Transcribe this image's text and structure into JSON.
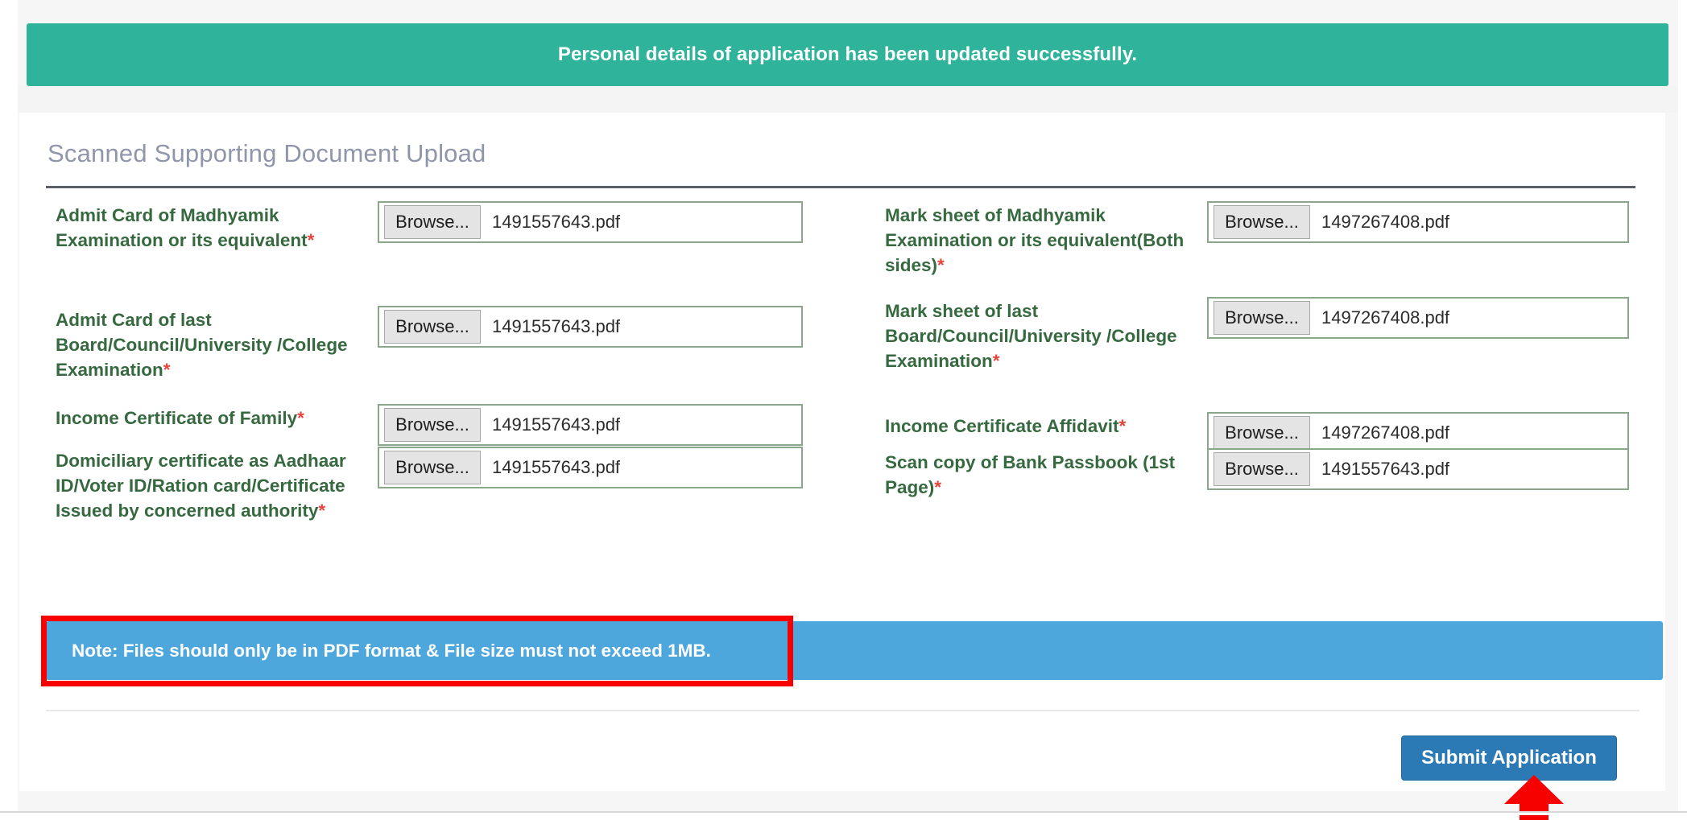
{
  "alert": {
    "message": "Personal details of application has been updated successfully.",
    "background_color": "#2fb39a",
    "text_color": "#ffffff"
  },
  "panel": {
    "title": "Scanned Supporting Document Upload",
    "title_color": "#8f96ab"
  },
  "uploads": [
    {
      "label": "Admit Card of Madhyamik Examination or its equivalent",
      "required": "*",
      "browse_label": "Browse...",
      "file_name": "1491557643.pdf"
    },
    {
      "label": "Mark sheet of Madhyamik Examination or its equivalent(Both sides)",
      "required": "*",
      "browse_label": "Browse...",
      "file_name": "1497267408.pdf"
    },
    {
      "label": "Admit Card of last Board/Council/University /College Examination",
      "required": "*",
      "browse_label": "Browse...",
      "file_name": "1491557643.pdf"
    },
    {
      "label": "Mark sheet of last Board/Council/University /College Examination",
      "required": "*",
      "browse_label": "Browse...",
      "file_name": "1497267408.pdf"
    },
    {
      "label": "Income Certificate of Family",
      "required": "*",
      "browse_label": "Browse...",
      "file_name": "1491557643.pdf"
    },
    {
      "label": "Income Certificate Affidavit",
      "required": "*",
      "browse_label": "Browse...",
      "file_name": "1497267408.pdf"
    },
    {
      "label": "Domiciliary certificate as Aadhaar ID/Voter ID/Ration card/Certificate Issued by concerned authority",
      "required": "*",
      "browse_label": "Browse...",
      "file_name": "1491557643.pdf"
    },
    {
      "label": "Scan copy of Bank Passbook (1st Page)",
      "required": "*",
      "browse_label": "Browse...",
      "file_name": "1491557643.pdf"
    }
  ],
  "note": {
    "text": "Note: Files should only be in PDF format & File size must not exceed 1MB.",
    "background_color": "#4da7dd",
    "highlight_color": "#f70000"
  },
  "footer": {
    "submit_label": "Submit Application",
    "submit_color": "#2b7ab5",
    "arrow_color": "#f70000"
  },
  "colors": {
    "label_green": "#36693f",
    "required_red": "#e8423b",
    "input_border": "#8aa78c"
  }
}
